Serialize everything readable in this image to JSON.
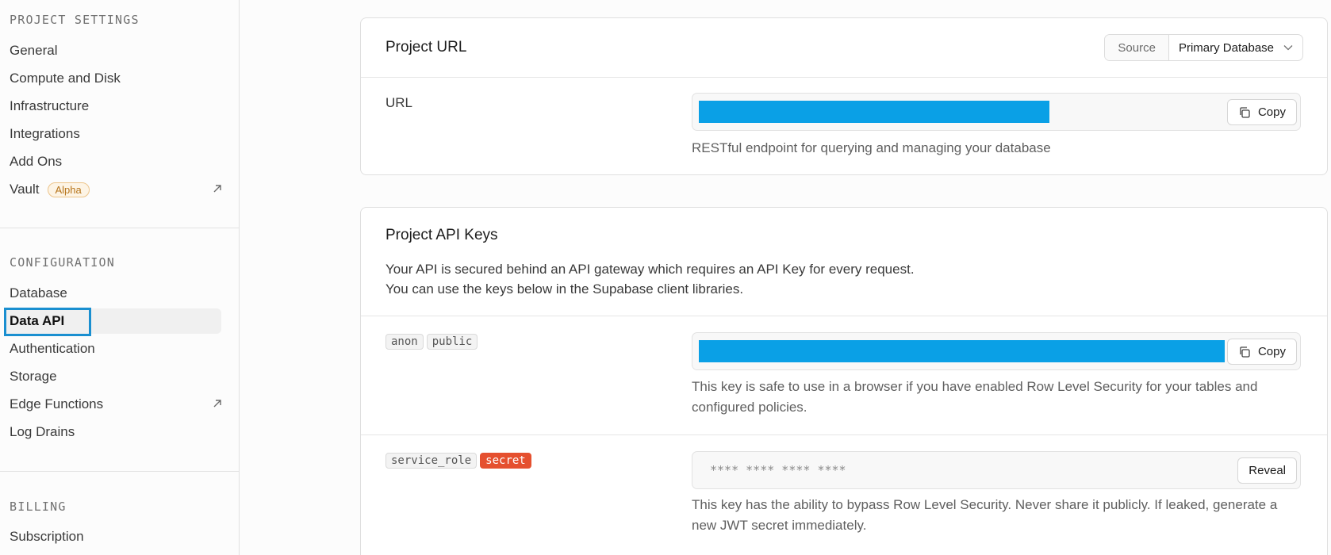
{
  "sidebar": {
    "project_settings": {
      "title": "PROJECT SETTINGS",
      "items": [
        {
          "label": "General"
        },
        {
          "label": "Compute and Disk"
        },
        {
          "label": "Infrastructure"
        },
        {
          "label": "Integrations"
        },
        {
          "label": "Add Ons"
        },
        {
          "label": "Vault",
          "badge": "Alpha",
          "icon": "external-link-icon"
        }
      ]
    },
    "configuration": {
      "title": "CONFIGURATION",
      "items": [
        {
          "label": "Database"
        },
        {
          "label": "Data API",
          "active": true
        },
        {
          "label": "Authentication"
        },
        {
          "label": "Storage"
        },
        {
          "label": "Edge Functions",
          "icon": "external-link-icon"
        },
        {
          "label": "Log Drains"
        }
      ]
    },
    "billing": {
      "title": "BILLING",
      "items": [
        {
          "label": "Subscription"
        }
      ]
    }
  },
  "project_url": {
    "title": "Project URL",
    "source_label": "Source",
    "source_value": "Primary Database",
    "url_label": "URL",
    "copy_label": "Copy",
    "help": "RESTful endpoint for querying and managing your database"
  },
  "api_keys": {
    "title": "Project API Keys",
    "desc_line1": "Your API is secured behind an API gateway which requires an API Key for every request.",
    "desc_line2": "You can use the keys below in the Supabase client libraries.",
    "anon": {
      "tag1": "anon",
      "tag2": "public",
      "copy_label": "Copy",
      "help": "This key is safe to use in a browser if you have enabled Row Level Security for your tables and configured policies."
    },
    "service_role": {
      "tag1": "service_role",
      "tag2": "secret",
      "masked": "**** **** **** ****",
      "reveal_label": "Reveal",
      "help": "This key has the ability to bypass Row Level Security. Never share it publicly. If leaked, generate a new JWT secret immediately."
    }
  },
  "colors": {
    "accent_highlight": "#1a8fd0",
    "redacted_fill": "#0aa0e6",
    "secret_tag": "#e5502f",
    "alpha_badge": "#b6741a"
  }
}
